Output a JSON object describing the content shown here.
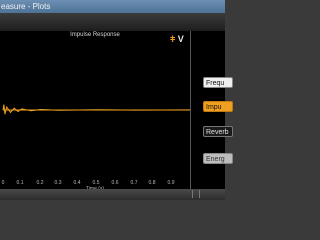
{
  "window": {
    "title": "easure - Plots"
  },
  "plot": {
    "title": "Impulse Response",
    "xlabel": "Time (s)",
    "x_ticks": [
      "0",
      "0.1",
      "0.2",
      "0.3",
      "0.4",
      "0.5",
      "0.6",
      "0.7",
      "0.8",
      "0.9"
    ]
  },
  "logo": {
    "text": "V",
    "icon": "speaker-wave-icon"
  },
  "panel": {
    "buttons": [
      {
        "label": "Frequ",
        "state": "normal"
      },
      {
        "label": "Impu",
        "state": "active"
      },
      {
        "label": "Reverb",
        "state": "normal"
      },
      {
        "label": "Energ",
        "state": "disabled"
      }
    ]
  },
  "colors": {
    "trace": "#f0a020",
    "background": "#000000"
  },
  "chart_data": {
    "type": "line",
    "title": "Impulse Response",
    "xlabel": "Time (s)",
    "ylabel": "",
    "xlim": [
      0,
      1
    ],
    "grid": false,
    "series": [
      {
        "color": "#f0a020",
        "x": [
          0,
          0.005,
          0.01,
          0.02,
          0.04,
          0.06,
          0.08,
          0.1,
          0.15,
          0.2,
          0.3,
          0.5,
          0.7,
          1.0
        ],
        "y": [
          0,
          0.9,
          -0.7,
          0.5,
          -0.4,
          0.3,
          -0.25,
          0.18,
          -0.12,
          0.08,
          -0.05,
          0.03,
          -0.02,
          0.01
        ]
      }
    ]
  }
}
